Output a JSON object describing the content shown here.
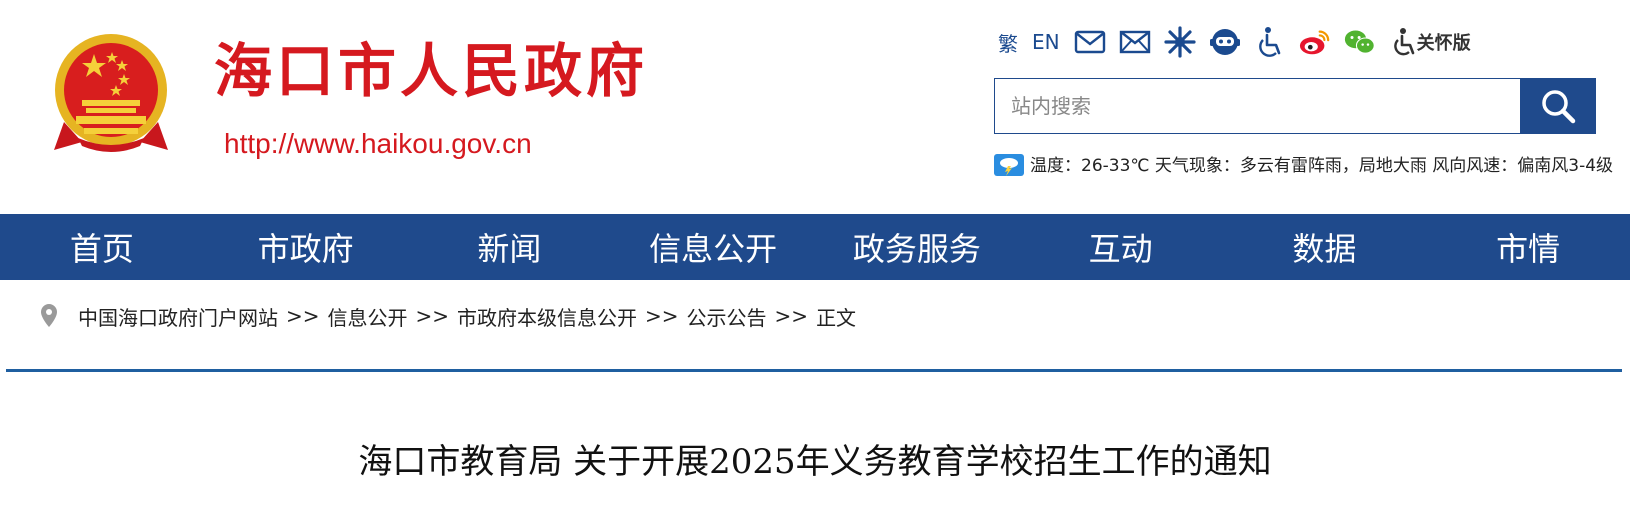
{
  "header": {
    "site_name": "海口市人民政府",
    "site_url": "http://www.haikou.gov.cn",
    "emblem_icon": "national-emblem-icon"
  },
  "toolbar": {
    "traditional_label": "繁",
    "english_label": "EN",
    "icons": [
      "mail-icon",
      "mailbox-icon",
      "asterisk-service-icon",
      "robot-assistant-icon",
      "accessibility-icon",
      "weibo-icon",
      "wechat-icon"
    ],
    "care_mode_label": "关怀版"
  },
  "search": {
    "placeholder": "站内搜索"
  },
  "weather": {
    "text": "温度：26-33℃ 天气现象：多云有雷阵雨，局地大雨 风向风速：偏南风3-4级"
  },
  "nav": {
    "items": [
      {
        "label": "首页"
      },
      {
        "label": "市政府"
      },
      {
        "label": "新闻"
      },
      {
        "label": "信息公开"
      },
      {
        "label": "政务服务"
      },
      {
        "label": "互动"
      },
      {
        "label": "数据"
      },
      {
        "label": "市情"
      }
    ]
  },
  "breadcrumb": {
    "items": [
      "中国海口政府门户网站",
      "信息公开",
      "市政府本级信息公开",
      "公示公告",
      "正文"
    ],
    "separator": ">>"
  },
  "article": {
    "title": "海口市教育局 关于开展2025年义务教育学校招生工作的通知"
  },
  "colors": {
    "brand_red": "#d5191f",
    "nav_blue": "#1f4a8c",
    "icon_blue": "#1b4a8f"
  }
}
